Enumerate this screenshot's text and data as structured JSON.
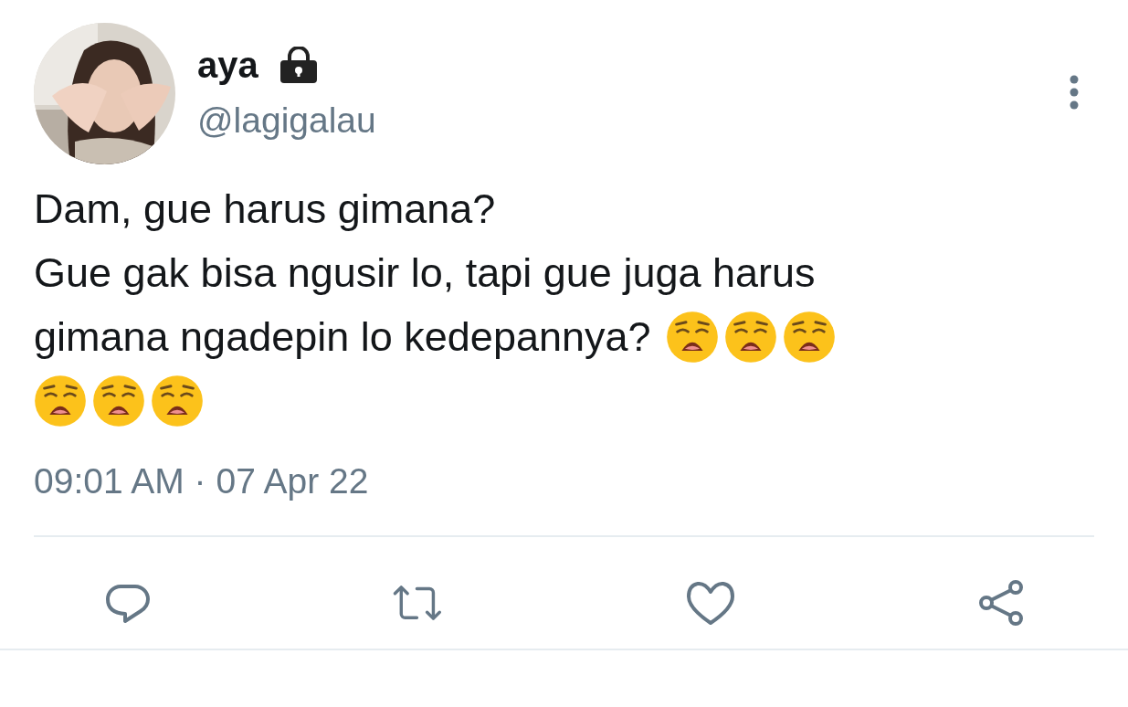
{
  "author": {
    "name": "aya",
    "protected": true,
    "handle": "@lagigalau"
  },
  "tweet": {
    "lines": [
      {
        "text": "Dam, gue harus gimana?"
      },
      {
        "text": "Gue gak bisa ngusir lo, tapi gue juga harus"
      },
      {
        "text": "gimana ngadepin lo kedepannya?",
        "emojis": [
          {
            "kind": "weary"
          },
          {
            "kind": "weary"
          },
          {
            "kind": "weary"
          }
        ]
      },
      {
        "emojis": [
          {
            "kind": "weary"
          },
          {
            "kind": "weary"
          },
          {
            "kind": "weary"
          }
        ]
      }
    ],
    "time": "09:01 AM · 07 Apr 22"
  },
  "actions": [
    {
      "kind": "reply"
    },
    {
      "kind": "retweet"
    },
    {
      "kind": "like"
    },
    {
      "kind": "share"
    }
  ]
}
